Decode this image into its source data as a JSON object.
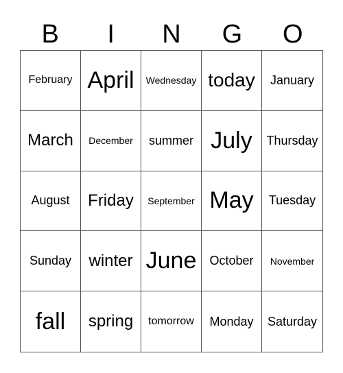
{
  "header": [
    "B",
    "I",
    "N",
    "G",
    "O"
  ],
  "cells": [
    {
      "text": "February",
      "size": "s2"
    },
    {
      "text": "April",
      "size": "s6"
    },
    {
      "text": "Wednesday",
      "size": "s1"
    },
    {
      "text": "today",
      "size": "s5"
    },
    {
      "text": "January",
      "size": "s3"
    },
    {
      "text": "March",
      "size": "s4"
    },
    {
      "text": "December",
      "size": "s1"
    },
    {
      "text": "summer",
      "size": "s3"
    },
    {
      "text": "July",
      "size": "s6"
    },
    {
      "text": "Thursday",
      "size": "s3"
    },
    {
      "text": "August",
      "size": "s3"
    },
    {
      "text": "Friday",
      "size": "s4"
    },
    {
      "text": "September",
      "size": "s1"
    },
    {
      "text": "May",
      "size": "s6"
    },
    {
      "text": "Tuesday",
      "size": "s3"
    },
    {
      "text": "Sunday",
      "size": "s3"
    },
    {
      "text": "winter",
      "size": "s4"
    },
    {
      "text": "June",
      "size": "s6"
    },
    {
      "text": "October",
      "size": "s3"
    },
    {
      "text": "November",
      "size": "s1"
    },
    {
      "text": "fall",
      "size": "s6"
    },
    {
      "text": "spring",
      "size": "s4"
    },
    {
      "text": "tomorrow",
      "size": "s2"
    },
    {
      "text": "Monday",
      "size": "s3"
    },
    {
      "text": "Saturday",
      "size": "s3"
    }
  ]
}
